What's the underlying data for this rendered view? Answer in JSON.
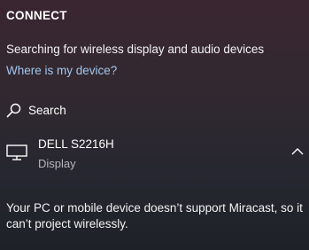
{
  "panel": {
    "title": "CONNECT",
    "status": "Searching for wireless display and audio devices",
    "help_link": "Where is my device?",
    "search_label": "Search"
  },
  "devices": [
    {
      "name": "DELL S2216H",
      "type": "Display",
      "icon": "monitor-icon",
      "expanded": true
    }
  ],
  "message": "Your PC or mobile device doesn’t support Miracast, so it can’t project wirelessly.",
  "colors": {
    "link": "#9fc8f0",
    "secondary_text": "#b8b4ba"
  }
}
